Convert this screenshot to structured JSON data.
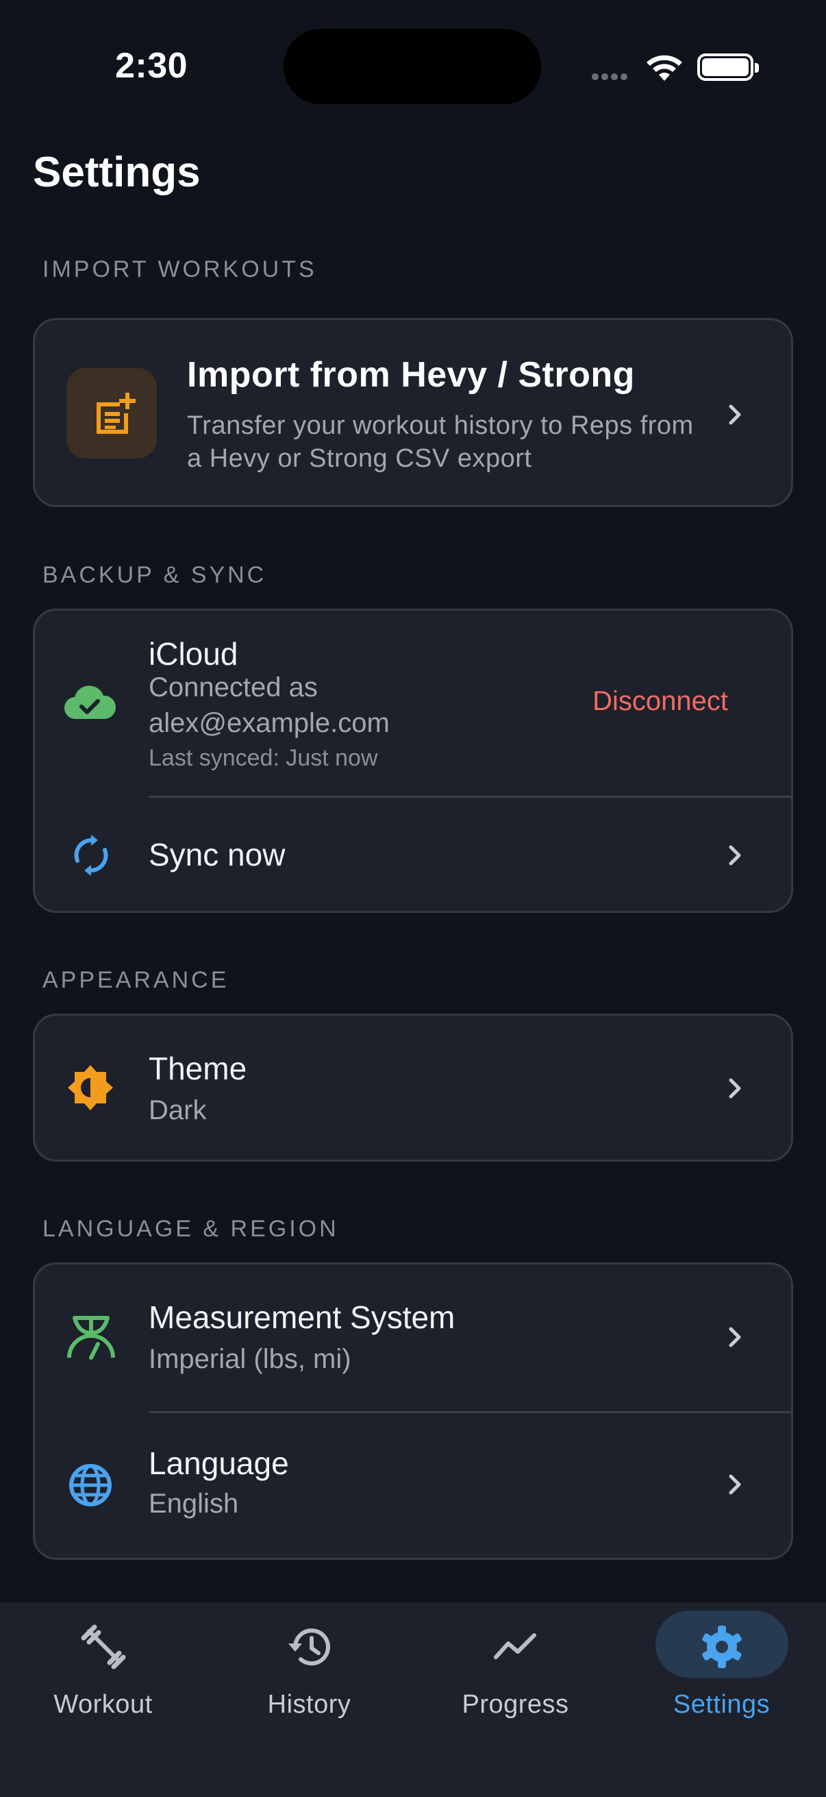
{
  "status_bar": {
    "time": "2:30"
  },
  "page_title": "Settings",
  "import_section": {
    "label": "IMPORT WORKOUTS",
    "item": {
      "title": "Import from Hevy / Strong",
      "description": "Transfer your workout history to Reps from a Hevy or Strong CSV export"
    }
  },
  "backup_section": {
    "label": "BACKUP & SYNC",
    "icloud": {
      "title": "iCloud",
      "connected_line": "Connected as",
      "email": "alex@example.com",
      "last_synced": "Last synced: Just now",
      "disconnect_label": "Disconnect"
    },
    "sync_now": {
      "title": "Sync now"
    }
  },
  "appearance_section": {
    "label": "APPEARANCE",
    "theme": {
      "title": "Theme",
      "value": "Dark"
    }
  },
  "language_section": {
    "label": "LANGUAGE & REGION",
    "measurement": {
      "title": "Measurement System",
      "value": "Imperial (lbs, mi)"
    },
    "language": {
      "title": "Language",
      "value": "English"
    }
  },
  "tab_bar": {
    "tabs": [
      {
        "label": "Workout",
        "icon": "dumbbell-icon",
        "active": false
      },
      {
        "label": "History",
        "icon": "history-icon",
        "active": false
      },
      {
        "label": "Progress",
        "icon": "trend-icon",
        "active": false
      },
      {
        "label": "Settings",
        "icon": "gear-icon",
        "active": true
      }
    ]
  },
  "colors": {
    "background": "#0f131b",
    "card": "#1c212b",
    "accent_blue": "#4aa3ee",
    "accent_orange": "#f39c1e",
    "accent_green": "#5cba6a",
    "danger": "#f36b63"
  }
}
